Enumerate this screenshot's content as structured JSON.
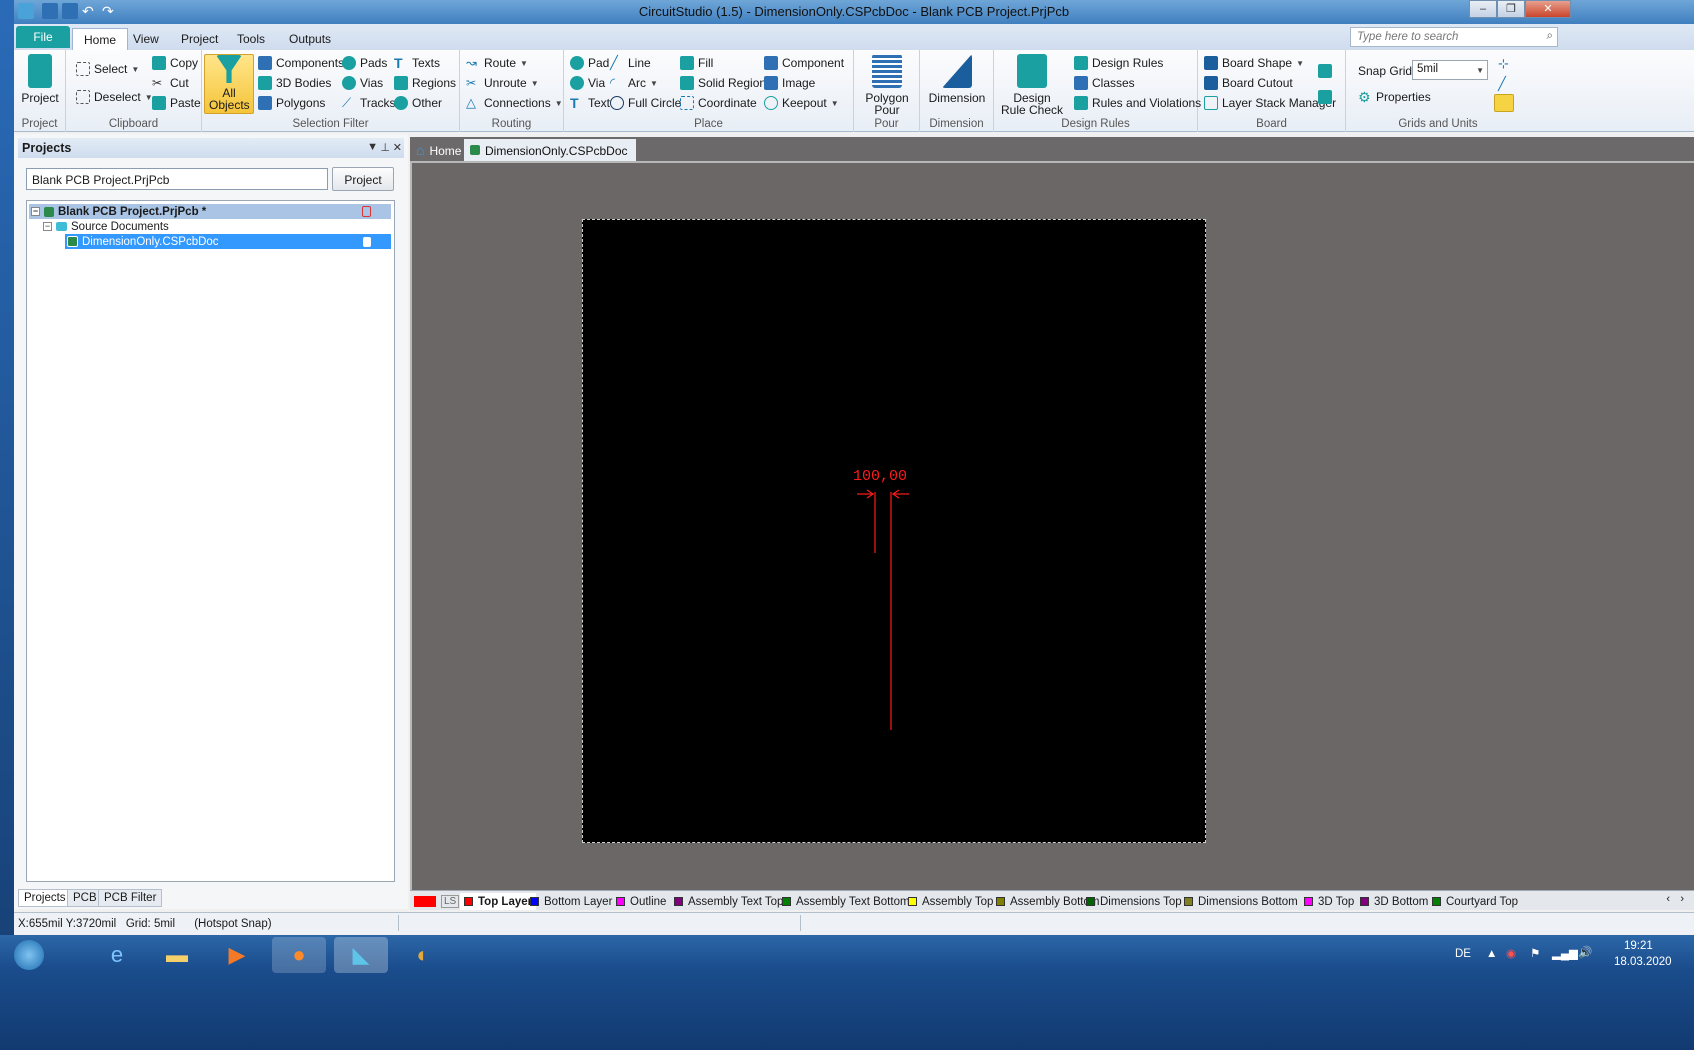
{
  "window": {
    "title": "CircuitStudio (1.5) - DimensionOnly.CSPcbDoc - Blank PCB Project.PrjPcb",
    "minimize": "–",
    "maximize": "❐",
    "close": "✕"
  },
  "ribbon_tabs": [
    "File",
    "Home",
    "View",
    "Project",
    "Tools",
    "Outputs"
  ],
  "search": {
    "placeholder": "Type here to search"
  },
  "ribbon": {
    "project": {
      "label": "Project",
      "button": "Project"
    },
    "clipboard": {
      "label": "Clipboard",
      "select": "Select",
      "deselect": "Deselect",
      "copy": "Copy",
      "cut": "Cut",
      "paste": "Paste"
    },
    "selection_filter": {
      "label": "Selection Filter",
      "all_objects": "All Objects",
      "components": "Components",
      "bodies": "3D Bodies",
      "polygons": "Polygons",
      "pads": "Pads",
      "vias": "Vias",
      "tracks": "Tracks",
      "texts": "Texts",
      "regions": "Regions",
      "other": "Other"
    },
    "routing": {
      "label": "Routing",
      "route": "Route",
      "unroute": "Unroute",
      "connections": "Connections"
    },
    "place": {
      "label": "Place",
      "pad": "Pad",
      "via": "Via",
      "text": "Text",
      "line": "Line",
      "arc": "Arc",
      "full_circle": "Full Circle",
      "fill": "Fill",
      "solid_region": "Solid Region",
      "coordinate": "Coordinate",
      "component": "Component",
      "image": "Image",
      "keepout": "Keepout"
    },
    "pour": {
      "label": "Pour",
      "button": "Polygon Pour"
    },
    "dimension": {
      "label": "Dimension",
      "button": "Dimension"
    },
    "design_rules": {
      "label": "Design Rules",
      "drc": "Design Rule Check",
      "rules": "Design Rules",
      "classes": "Classes",
      "violations": "Rules and Violations"
    },
    "board": {
      "label": "Board",
      "shape": "Board Shape",
      "cutout": "Board Cutout",
      "stack": "Layer Stack Manager"
    },
    "grids": {
      "label": "Grids and Units",
      "snap_label": "Snap Grid",
      "snap_value": "5mil",
      "properties": "Properties"
    }
  },
  "projects_panel": {
    "title": "Projects",
    "project_field": "Blank PCB Project.PrjPcb",
    "project_button": "Project",
    "tree": {
      "root": "Blank PCB Project.PrjPcb *",
      "folder": "Source Documents",
      "document": "DimensionOnly.CSPcbDoc"
    },
    "tabs": [
      "Projects",
      "PCB",
      "PCB Filter"
    ]
  },
  "doc_tabs": {
    "home": "Home",
    "document": "DimensionOnly.CSPcbDoc"
  },
  "canvas": {
    "dimension_value": "100,00",
    "dimension_color": "#ff1a1a"
  },
  "layers": {
    "ls": "LS",
    "items": [
      {
        "name": "Top Layer",
        "color": "#ff0000"
      },
      {
        "name": "Bottom Layer",
        "color": "#0000ff"
      },
      {
        "name": "Outline",
        "color": "#ff00ff"
      },
      {
        "name": "Assembly Text Top",
        "color": "#800080"
      },
      {
        "name": "Assembly Text Bottom",
        "color": "#008000"
      },
      {
        "name": "Assembly Top",
        "color": "#ffff00"
      },
      {
        "name": "Assembly Bottom",
        "color": "#808000"
      },
      {
        "name": "Dimensions Top",
        "color": "#006400"
      },
      {
        "name": "Dimensions Bottom",
        "color": "#808020"
      },
      {
        "name": "3D Top",
        "color": "#ff00ff"
      },
      {
        "name": "3D Bottom",
        "color": "#800080"
      },
      {
        "name": "Courtyard Top",
        "color": "#008000"
      }
    ]
  },
  "status": {
    "coords": "X:655mil Y:3720mil",
    "grid": "Grid: 5mil",
    "snap": "(Hotspot Snap)"
  },
  "taskbar": {
    "lang": "DE",
    "time": "19:21",
    "date": "18.03.2020"
  }
}
